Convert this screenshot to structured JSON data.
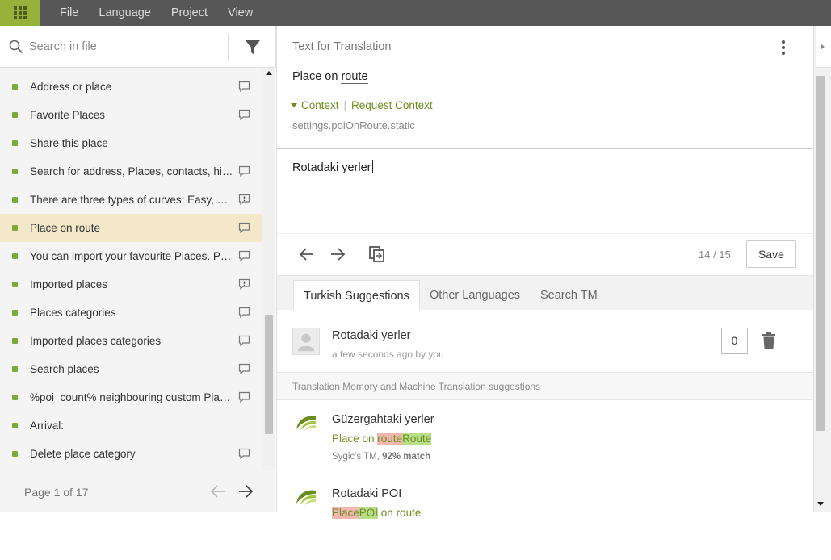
{
  "menu": {
    "items": [
      "File",
      "Language",
      "Project",
      "View"
    ]
  },
  "sidebar": {
    "search_placeholder": "Search in file",
    "items": [
      {
        "label": "Address or place",
        "icon": "comment-icon"
      },
      {
        "label": "Favorite Places",
        "icon": "comment-icon"
      },
      {
        "label": "Share this place",
        "icon": ""
      },
      {
        "label": "Search for address, Places, contacts, his…",
        "icon": "comment-icon"
      },
      {
        "label": "There are three types of curves: Easy, M…",
        "icon": "issue-icon"
      },
      {
        "label": "Place on route",
        "icon": "comment-icon",
        "active": true
      },
      {
        "label": "You can import your favourite Places. P…",
        "icon": "comment-icon"
      },
      {
        "label": "Imported places",
        "icon": "issue-icon"
      },
      {
        "label": "Places categories",
        "icon": "comment-icon"
      },
      {
        "label": "Imported places categories",
        "icon": "comment-icon"
      },
      {
        "label": "Search places",
        "icon": "comment-icon"
      },
      {
        "label": "%poi_count% neighbouring custom Plac…",
        "icon": "comment-icon"
      },
      {
        "label": "Arrival:",
        "icon": ""
      },
      {
        "label": "Delete place category",
        "icon": "comment-icon"
      }
    ],
    "page_text": "Page 1 of 17"
  },
  "editor": {
    "section_title": "Text for Translation",
    "source_prefix": "Place on ",
    "source_term": "route",
    "context_label": "Context",
    "request_context_label": "Request Context",
    "context_key": "settings.poiOnRoute.static",
    "translation": "Rotadaki yerler",
    "counter": "14 / 15",
    "save_label": "Save"
  },
  "tabs": [
    "Turkish Suggestions",
    "Other Languages",
    "Search TM"
  ],
  "own_suggestion": {
    "text": "Rotadaki yerler",
    "meta": "a few seconds ago by you",
    "votes": "0"
  },
  "tm": {
    "header": "Translation Memory and Machine Translation suggestions",
    "items": [
      {
        "text": "Güzergahtaki yerler",
        "source_prefix": "Place on ",
        "deleted": "route",
        "inserted": "Route",
        "source_suffix": "",
        "meta_prefix": "Sygic's TM, ",
        "meta_match": "92% match"
      },
      {
        "text": "Rotadaki POI",
        "source_prefix": "",
        "deleted": "Place",
        "inserted": "POI",
        "source_suffix": " on route",
        "meta_prefix": "",
        "meta_match": ""
      }
    ]
  },
  "colors": {
    "accent_green": "#95b33b",
    "active_row": "#f3e8c9",
    "topbar": "#575757",
    "diff_deleted": "#f2b8b0",
    "diff_inserted": "#b9de8a"
  }
}
